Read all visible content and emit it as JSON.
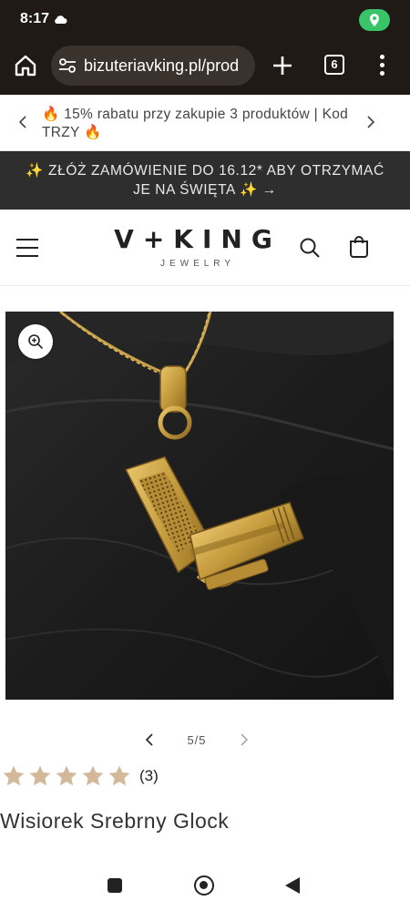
{
  "status_bar": {
    "time": "8:17"
  },
  "browser": {
    "url": "bizuteriavking.pl/prod",
    "tab_count": "6"
  },
  "promo": {
    "text": "🔥 15% rabatu przy zakupie 3 produktów | Kod TRZY 🔥"
  },
  "announcement": {
    "text": "✨ ZŁÓŻ ZAMÓWIENIE DO 16.12* ABY OTRZYMAĆ JE NA ŚWIĘTA ✨ →"
  },
  "header": {
    "logo_main": "V+KING",
    "logo_sub": "JEWELRY"
  },
  "gallery": {
    "pager": "5/5",
    "current": 5,
    "total": 5
  },
  "product": {
    "rating": 5,
    "review_count": "(3)",
    "title": "Wisiorek Srebrny Glock"
  },
  "colors": {
    "chrome_bg": "#1f1a16",
    "announcement_bg": "#2e2e2e",
    "star": "#d3b89a",
    "location_pill": "#39c46a"
  },
  "icons": [
    "cloud-icon",
    "location-icon",
    "home-icon",
    "tune-icon",
    "plus-icon",
    "tabs-icon",
    "more-vert-icon",
    "chevron-left-icon",
    "chevron-right-icon",
    "hamburger-icon",
    "search-icon",
    "bag-icon",
    "zoom-in-icon",
    "star-icon"
  ]
}
